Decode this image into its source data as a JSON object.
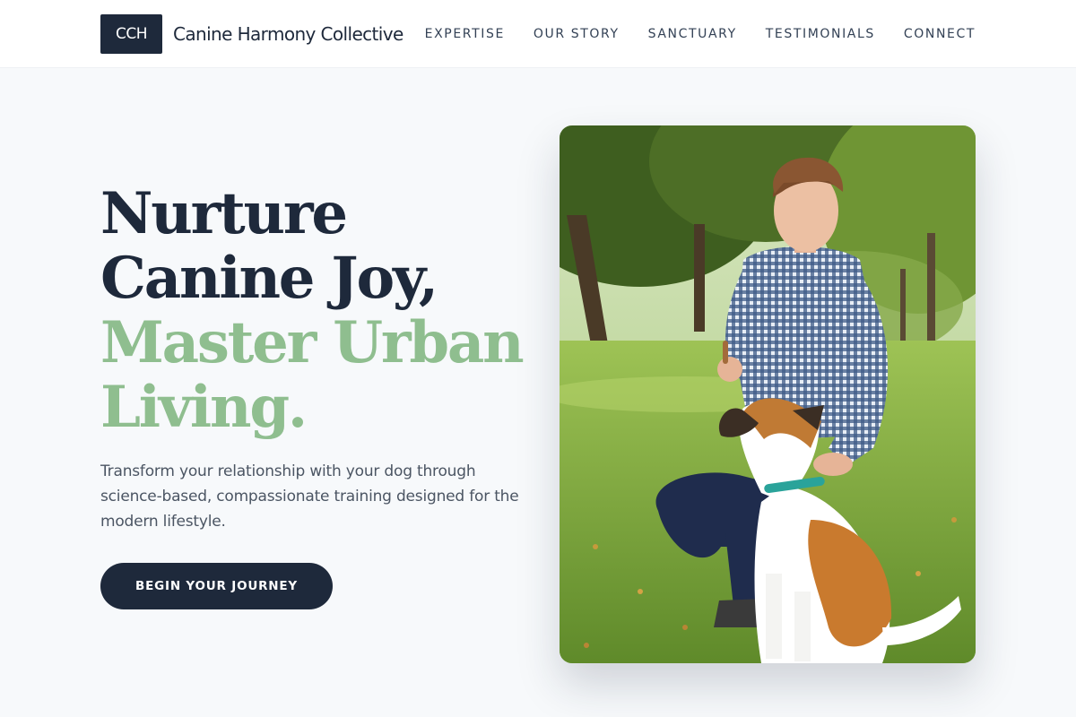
{
  "header": {
    "logo_text": "CCH",
    "brand_name": "Canine Harmony Collective",
    "nav": [
      {
        "label": "EXPERTISE"
      },
      {
        "label": "OUR STORY"
      },
      {
        "label": "SANCTUARY"
      },
      {
        "label": "TESTIMONIALS"
      },
      {
        "label": "CONNECT"
      }
    ]
  },
  "hero": {
    "title_lines_dark": [
      "Nurture",
      "Canine Joy,"
    ],
    "title_lines_accent": [
      "Master Urban",
      "Living."
    ],
    "subtitle": "Transform your relationship with your dog through science-based, compassionate training designed for the modern lifestyle.",
    "cta_label": "BEGIN YOUR JOURNEY",
    "image_subject": "man-training-dog-in-park"
  },
  "colors": {
    "primary_dark": "#1e293b",
    "accent_green": "#8fbe8f",
    "background": "#f7f9fb",
    "text_muted": "#4b5563"
  }
}
